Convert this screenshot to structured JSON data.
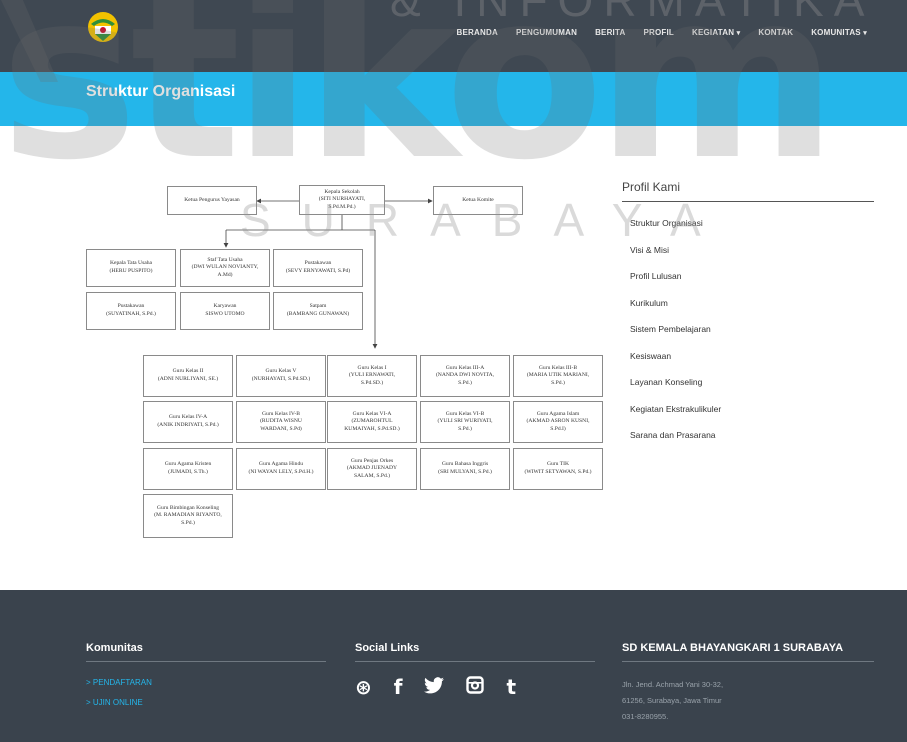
{
  "watermark": {
    "big": "stikom",
    "sub": "SURABAYA",
    "top": "& INFORMATIKA"
  },
  "nav": {
    "items": [
      {
        "label": "BERANDA"
      },
      {
        "label": "PENGUMUMAN"
      },
      {
        "label": "BERITA"
      },
      {
        "label": "PROFIL"
      },
      {
        "label": "KEGIATAN",
        "caret": "▾"
      },
      {
        "label": "KONTAK"
      },
      {
        "label": "KOMUNITAS",
        "caret": "▾"
      }
    ]
  },
  "page": {
    "title": "Struktur Organisasi"
  },
  "org": {
    "top": {
      "yayasan": "Ketua Pengurus Yayasan",
      "kepsek": "Kepala Sekolah\n(SITI NURHAYATI,\nS.Pd.M.Pd.)",
      "komite": "Ketua Komite"
    },
    "staff": [
      "Kepala Tata Usaha\n(HERU PUSPITO)",
      "Staf Tata Usaha\n(DWI WULAN NOVIANTY,\nA.Md)",
      "Pustakawan\n(SEVY ERNYAWATI, S.Pd)",
      "Pustakawan\n(SUYATINAH, S.Pd.)",
      "Karyawan\nSISWO UTOMO",
      "Satpam\n(BAMBANG GUNAWAN)"
    ],
    "teachers": [
      "Guru Kelas II\n(ADNI NURLIYANI, SE.)",
      "Guru Kelas V\n(NURHAYATI, S.Pd.SD.)",
      "Guru Kelas I\n(YULI ERNAWATI,\nS.Pd.SD.)",
      "Guru Kelas III-A\n(NANDA DWI NOVITA,\nS.Pd.)",
      "Guru Kelas III-B\n(MARIA UTIK MARIANI,\nS.Pd.)",
      "Guru Kelas IV-A\n(ANIK INDRIYATI, S.Pd.)",
      "Guru Kelas IV-B\n(RUDITA WISNU\nWARDANI, S.Pd)",
      "Guru Kelas VI-A\n(ZUMAROHTUL\nKUMAIYAH, S.Pd.SD.)",
      "Guru Kelas VI-B\n(YULI SRI WURIYATI,\nS.Pd.)",
      "Guru Agama Islam\n(AKMAD ASRON KUSNI,\nS.Pd.I)",
      "Guru Agama Kristen\n(JUMADI, S.Th.)",
      "Guru Agama Hindu\n(NI WAYAN LELY, S.Pd.H.)",
      "Guru Penjas Orkes\n(AKMAD JUENADY\nSALAM, S.Pd.)",
      "Guru Bahasa Inggris\n(SRI MULYANI, S.Pd.)",
      "Guru TIK\n(WIWIT SETYAWAN, S.Pd.)",
      "Guru Bimbingan Konseling\n(M. RAMADIAN RIYANTO,\nS.Pd.)"
    ]
  },
  "sidebar": {
    "title": "Profil Kami",
    "items": [
      "Struktur Organisasi",
      "Visi & Misi",
      "Profil Lulusan",
      "Kurikulum",
      "Sistem Pembelajaran",
      "Kesiswaan",
      "Layanan Konseling",
      "Kegiatan Ekstrakulikuler",
      "Sarana dan Prasarana"
    ]
  },
  "footer": {
    "komunitas": {
      "title": "Komunitas",
      "links": [
        "> PENDAFTARAN",
        "> UJIN ONLINE"
      ]
    },
    "social": {
      "title": "Social Links",
      "icons": [
        "dribbble-icon",
        "facebook-icon",
        "twitter-icon",
        "instagram-icon",
        "tumblr-icon"
      ]
    },
    "school": {
      "title": "SD KEMALA BHAYANGKARI 1 SURABAYA",
      "address": [
        "Jln. Jend. Achmad Yani 30-32,",
        "61256, Surabaya, Jawa Timur",
        "031-8280955."
      ]
    }
  },
  "colors": {
    "accent": "#24b6ea",
    "header": "#3f4852",
    "footer": "#3a434d"
  }
}
